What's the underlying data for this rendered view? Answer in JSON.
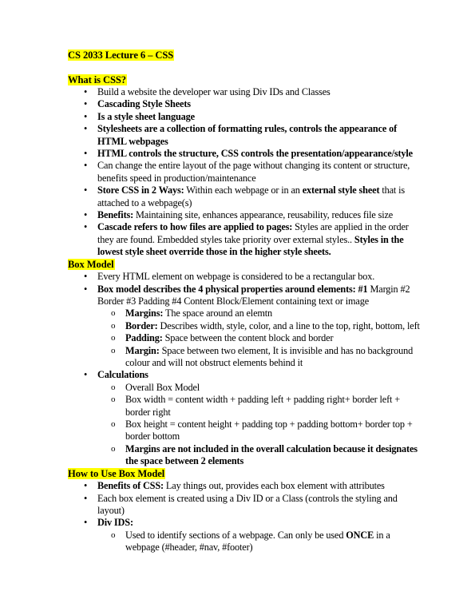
{
  "document": {
    "title": "CS 2033 Lecture 6 – CSS",
    "highlight_color": "#FFFF00",
    "text_color": "#000000",
    "background_color": "#FFFFFF",
    "bullet_glyph_level1": "•",
    "bullet_glyph_level2": "o",
    "sections": [
      {
        "heading": "What is CSS?",
        "bullets": [
          {
            "runs": [
              {
                "text": "Build a website the developer war using Div IDs and Classes",
                "bold": false
              }
            ],
            "children": []
          },
          {
            "runs": [
              {
                "text": "Cascading Style Sheets",
                "bold": true
              }
            ],
            "children": []
          },
          {
            "runs": [
              {
                "text": "Is a style sheet language",
                "bold": true
              }
            ],
            "children": []
          },
          {
            "runs": [
              {
                "text": "Stylesheets are a collection of formatting rules, controls the appearance of HTML webpages",
                "bold": true
              }
            ],
            "children": []
          },
          {
            "runs": [
              {
                "text": "HTML controls the structure, CSS controls the presentation/appearance/style",
                "bold": true
              }
            ],
            "children": []
          },
          {
            "runs": [
              {
                "text": "Can change the entire layout of the page without changing its content or structure, benefits speed in production/maintenance",
                "bold": false
              }
            ],
            "children": []
          },
          {
            "runs": [
              {
                "text": "Store CSS in 2 Ways:",
                "bold": true
              },
              {
                "text": " Within each webpage or in an ",
                "bold": false
              },
              {
                "text": "external style sheet",
                "bold": true
              },
              {
                "text": " that is attached to a webpage(s)",
                "bold": false
              }
            ],
            "children": []
          },
          {
            "runs": [
              {
                "text": "Benefits:",
                "bold": true
              },
              {
                "text": " Maintaining site, enhances appearance, reusability, reduces file size",
                "bold": false
              }
            ],
            "children": []
          },
          {
            "runs": [
              {
                "text": "Cascade refers to how files are applied to pages:",
                "bold": true
              },
              {
                "text": " Styles are applied in the order they are found. Embedded styles take priority over external styles.. ",
                "bold": false
              },
              {
                "text": "Styles in the lowest style sheet override those in the higher style sheets.",
                "bold": true
              }
            ],
            "children": []
          }
        ]
      },
      {
        "heading": "Box Model",
        "bullets": [
          {
            "runs": [
              {
                "text": "Every HTML element on webpage is considered to be a rectangular box.",
                "bold": false
              }
            ],
            "children": []
          },
          {
            "runs": [
              {
                "text": "Box model describes the 4 physical properties around elements: #1",
                "bold": true
              },
              {
                "text": " Margin #2 Border #3 Padding #4 Content Block/Element containing text or image",
                "bold": false
              }
            ],
            "children": [
              {
                "runs": [
                  {
                    "text": "Margins:",
                    "bold": true
                  },
                  {
                    "text": " The space around an elemtn",
                    "bold": false
                  }
                ]
              },
              {
                "runs": [
                  {
                    "text": "Border:",
                    "bold": true
                  },
                  {
                    "text": " Describes width, style, color, and a line to the top, right, bottom, left",
                    "bold": false
                  }
                ]
              },
              {
                "runs": [
                  {
                    "text": "Padding:",
                    "bold": true
                  },
                  {
                    "text": " Space between the content block and border",
                    "bold": false
                  }
                ]
              },
              {
                "runs": [
                  {
                    "text": "Margin:",
                    "bold": true
                  },
                  {
                    "text": " Space between two element, It is invisible and has no background colour and will not obstruct elements behind it",
                    "bold": false
                  }
                ]
              }
            ]
          },
          {
            "runs": [
              {
                "text": "Calculations",
                "bold": true
              }
            ],
            "children": [
              {
                "runs": [
                  {
                    "text": "Overall Box Model",
                    "bold": false
                  }
                ]
              },
              {
                "runs": [
                  {
                    "text": "Box width = content width + padding left + padding right+ border left + border right",
                    "bold": false
                  }
                ]
              },
              {
                "runs": [
                  {
                    "text": "Box height = content height + padding top + padding bottom+ border top + border bottom",
                    "bold": false
                  }
                ]
              },
              {
                "runs": [
                  {
                    "text": "Margins are not included in the overall calculation because it designates the space between 2 elements",
                    "bold": true
                  }
                ]
              }
            ]
          }
        ]
      },
      {
        "heading": "How to Use Box Model",
        "bullets": [
          {
            "runs": [
              {
                "text": "Benefits of CSS:",
                "bold": true
              },
              {
                "text": " Lay things out, provides each box element with attributes",
                "bold": false
              }
            ],
            "children": []
          },
          {
            "runs": [
              {
                "text": "Each box element is created using a Div ID or a Class (controls the styling and layout)",
                "bold": false
              }
            ],
            "children": []
          },
          {
            "runs": [
              {
                "text": "Div IDS:",
                "bold": true
              }
            ],
            "children": [
              {
                "runs": [
                  {
                    "text": "Used to identify sections of a webpage. Can only be used ",
                    "bold": false
                  },
                  {
                    "text": "ONCE",
                    "bold": true
                  },
                  {
                    "text": " in a webpage (#header, #nav, #footer)",
                    "bold": false
                  }
                ]
              }
            ]
          }
        ]
      }
    ]
  }
}
